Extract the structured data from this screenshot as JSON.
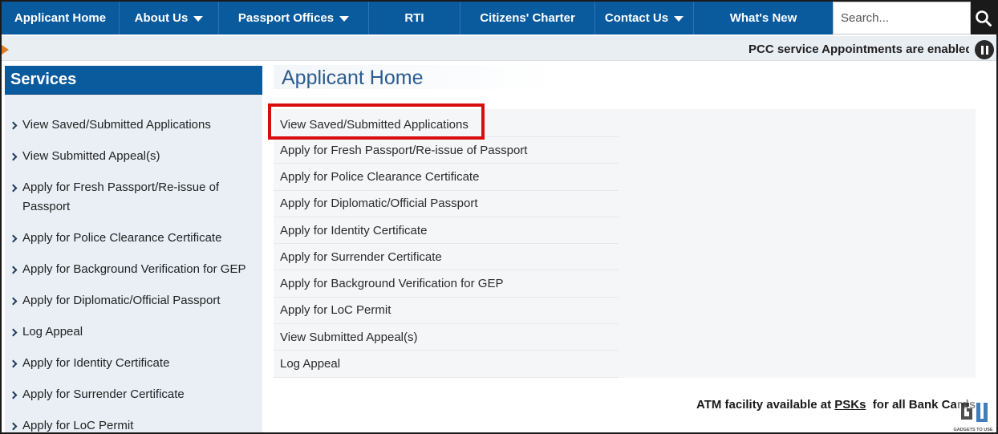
{
  "nav": {
    "items": [
      {
        "label": "Applicant Home",
        "dropdown": false
      },
      {
        "label": "About Us",
        "dropdown": true
      },
      {
        "label": "Passport Offices",
        "dropdown": true
      },
      {
        "label": "RTI",
        "dropdown": false
      },
      {
        "label": "Citizens' Charter",
        "dropdown": false
      },
      {
        "label": "Contact Us",
        "dropdown": true
      },
      {
        "label": "What's New",
        "dropdown": false
      }
    ],
    "search_placeholder": "Search..."
  },
  "ticker": {
    "text": "PCC service Appointments are enabled"
  },
  "sidebar": {
    "title": "Services",
    "items": [
      {
        "label": "View Saved/Submitted Applications"
      },
      {
        "label": "View Submitted Appeal(s)"
      },
      {
        "label": "Apply for Fresh Passport/Re-issue of Passport"
      },
      {
        "label": "Apply for Police Clearance Certificate"
      },
      {
        "label": "Apply for Background Verification for GEP"
      },
      {
        "label": "Apply for Diplomatic/Official Passport"
      },
      {
        "label": "Log Appeal"
      },
      {
        "label": "Apply for Identity Certificate"
      },
      {
        "label": "Apply for Surrender Certificate"
      },
      {
        "label": "Apply for LoC Permit"
      }
    ]
  },
  "main": {
    "title": "Applicant Home",
    "links": [
      {
        "label": "View Saved/Submitted Applications"
      },
      {
        "label": "Apply for Fresh Passport/Re-issue of Passport"
      },
      {
        "label": "Apply for Police Clearance Certificate"
      },
      {
        "label": "Apply for Diplomatic/Official Passport"
      },
      {
        "label": "Apply for Identity Certificate"
      },
      {
        "label": "Apply for Surrender Certificate"
      },
      {
        "label": "Apply for Background Verification for GEP"
      },
      {
        "label": "Apply for LoC Permit"
      },
      {
        "label": "View Submitted Appeal(s)"
      },
      {
        "label": "Log Appeal"
      }
    ],
    "highlight_color": "#d80e0e"
  },
  "notice": {
    "prefix": "ATM facility available at ",
    "link": "PSKs",
    "suffix": "  for all Bank Cards"
  },
  "watermark": {
    "text": "GADGETS TO USE"
  },
  "colors": {
    "nav_bg": "#0a5a9e",
    "sidebar_bg": "#e9eff5",
    "title_color": "#2d5c8e"
  }
}
